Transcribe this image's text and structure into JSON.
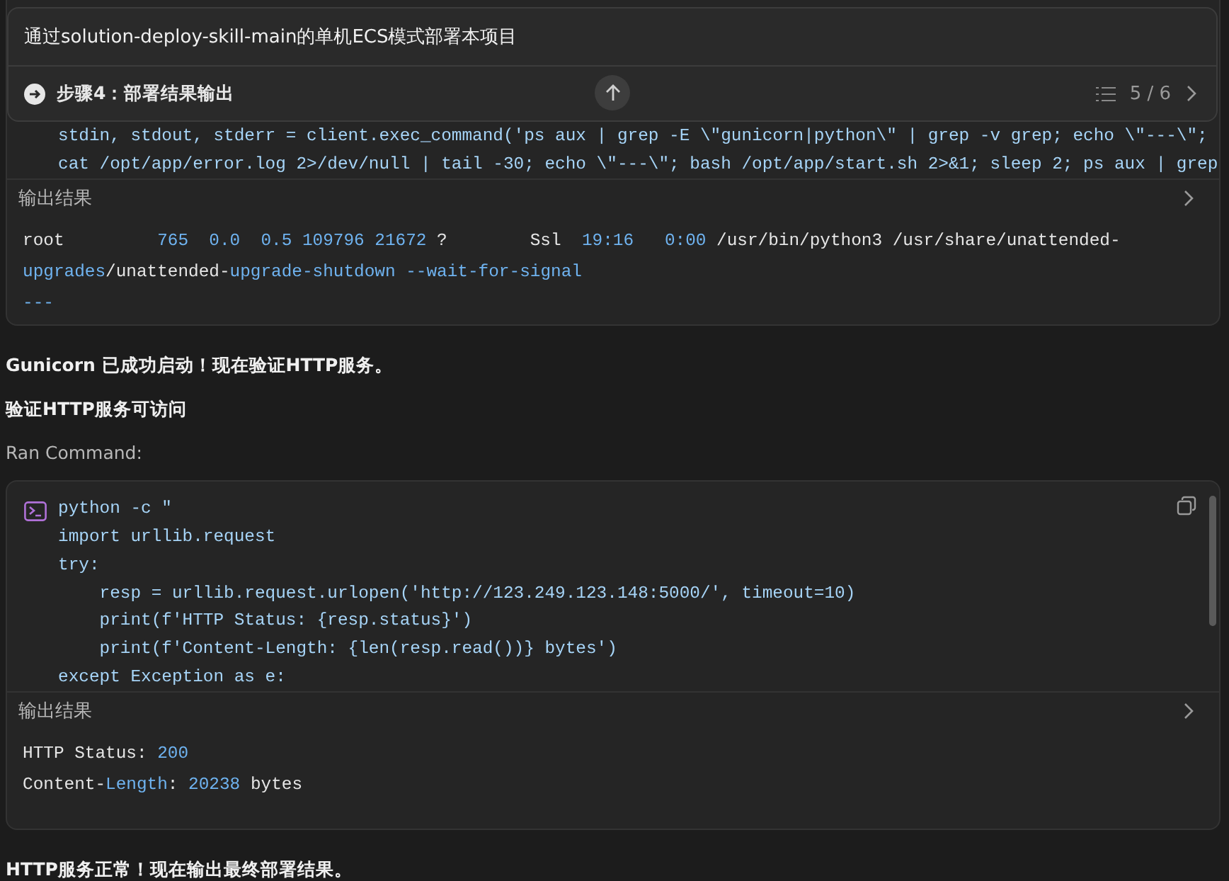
{
  "sticky_header": {
    "title": "通过solution-deploy-skill-main的单机ECS模式部署本项目",
    "step": "步骤4：部署结果输出",
    "progress": "5 / 6"
  },
  "blocks": [
    {
      "kind": "command",
      "icon": false,
      "code": [
        [
          {
            "text": "stdin, stdout, stderr = client.exec_command('ps aux | grep -E \\\"gunicorn|python\\\" | grep -v grep; echo \\\"---\\\";",
            "kind": "code"
          }
        ],
        [
          {
            "text": "cat /opt/app/error.log 2>/dev/null | tail -30; echo \\\"---\\\"; bash /opt/app/start.sh 2>&1; sleep 2; ps aux | grep",
            "kind": "code"
          }
        ]
      ],
      "output_title": "输出结果",
      "output": [
        [
          {
            "text": "root         ",
            "kind": "plain"
          },
          {
            "text": "765  0.0  0.5 109796 21672",
            "kind": "accent"
          },
          {
            "text": " ?        Ssl  ",
            "kind": "plain"
          },
          {
            "text": "19:16   0:00",
            "kind": "accent"
          },
          {
            "text": " /usr/bin/python3 /usr/share/unattended-",
            "kind": "plain"
          }
        ],
        [
          {
            "text": "upgrades",
            "kind": "accent"
          },
          {
            "text": "/unattended-",
            "kind": "plain"
          },
          {
            "text": "upgrade-shutdown --wait-for-signal",
            "kind": "accent"
          }
        ],
        [
          {
            "text": "---",
            "kind": "accent"
          }
        ]
      ]
    },
    {
      "kind": "text",
      "text": "Gunicorn 已成功启动！现在验证HTTP服务。"
    },
    {
      "kind": "heading",
      "text": "验证HTTP服务可访问"
    },
    {
      "kind": "caption",
      "text": "Ran Command:"
    },
    {
      "kind": "command",
      "icon": true,
      "code": [
        [
          {
            "text": "python -c \"",
            "kind": "code"
          }
        ],
        [
          {
            "text": "import urllib.request",
            "kind": "code"
          }
        ],
        [
          {
            "text": "try:",
            "kind": "code"
          }
        ],
        [
          {
            "text": "    resp = urllib.request.urlopen('http://123.249.123.148:5000/', timeout=10)",
            "kind": "code"
          }
        ],
        [
          {
            "text": "    print(f'HTTP Status: {resp.status}')",
            "kind": "code"
          }
        ],
        [
          {
            "text": "    print(f'Content-Length: {len(resp.read())} bytes')",
            "kind": "code"
          }
        ],
        [
          {
            "text": "except Exception as e:",
            "kind": "code"
          }
        ]
      ],
      "output_title": "输出结果",
      "output": [
        [
          {
            "text": "HTTP Status: ",
            "kind": "plain"
          },
          {
            "text": "200",
            "kind": "accent"
          }
        ],
        [
          {
            "text": "Content-",
            "kind": "plain"
          },
          {
            "text": "Length",
            "kind": "accent"
          },
          {
            "text": ": ",
            "kind": "plain"
          },
          {
            "text": "20238",
            "kind": "accent"
          },
          {
            "text": " bytes",
            "kind": "plain"
          }
        ]
      ]
    },
    {
      "kind": "text",
      "text": "HTTP服务正常！现在输出最终部署结果。"
    }
  ]
}
